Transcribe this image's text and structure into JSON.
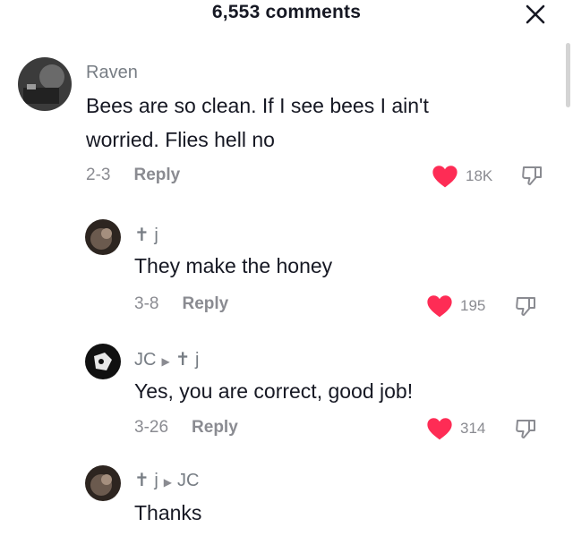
{
  "header": {
    "comment_count": "6,553 comments"
  },
  "comments": [
    {
      "author": "Raven",
      "text": "Bees are so clean. If I see bees I ain't worried. Flies hell no",
      "date": "2-3",
      "reply": "Reply",
      "likes": "18K"
    },
    {
      "author": "✝ j",
      "text": "They make the honey",
      "date": "3-8",
      "reply": "Reply",
      "likes": "195"
    },
    {
      "author": "JC",
      "reply_to": "✝ j",
      "text": "Yes, you are correct, good job!",
      "date": "3-26",
      "reply": "Reply",
      "likes": "314"
    },
    {
      "author": "✝ j",
      "reply_to": "JC",
      "text": "Thanks"
    }
  ],
  "colors": {
    "like_heart": "#fe2c55",
    "text": "#161823",
    "meta": "#8a8b91"
  },
  "icons": [
    "close-icon",
    "heart-icon",
    "dislike-icon",
    "reply-arrow-icon"
  ]
}
